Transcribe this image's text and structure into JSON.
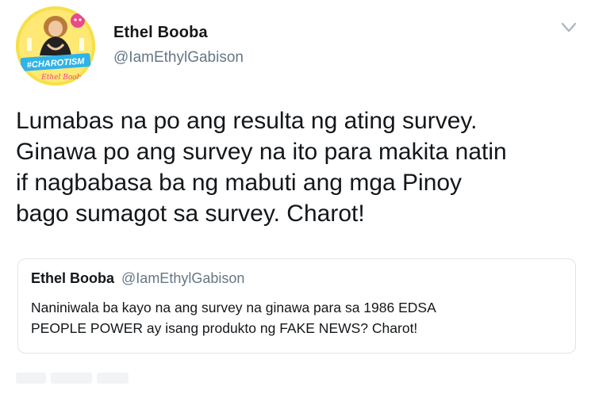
{
  "author": {
    "name": "Ethel Booba",
    "handle": "@IamEthylGabison",
    "avatar": {
      "badge_text": "#CHAROTISM",
      "script_text": "Ethel Booba",
      "bg_color": "#f6e04a",
      "badge_color": "#2fb3e8",
      "accent_color": "#e84a8a"
    }
  },
  "tweet": {
    "lines": [
      "Lumabas na po ang resulta ng ating survey.",
      "Ginawa po ang survey na ito para makita natin",
      "if nagbabasa ba ng mabuti ang mga Pinoy",
      "bago sumagot sa survey. Charot!"
    ]
  },
  "quoted_tweet": {
    "name": "Ethel Booba",
    "handle": "@IamEthylGabison",
    "lines": [
      "Naniniwala ba kayo na ang survey na ginawa para sa 1986 EDSA",
      "PEOPLE POWER ay isang produkto ng FAKE NEWS? Charot!"
    ]
  },
  "menu": {
    "icon": "chevron-down-icon"
  }
}
